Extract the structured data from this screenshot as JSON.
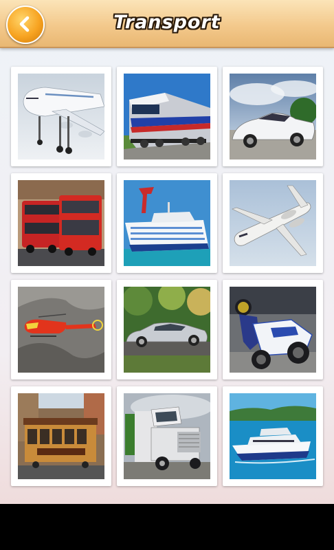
{
  "header": {
    "title": "Transport",
    "back_icon": "chevron-left-icon"
  },
  "colors": {
    "header_top": "#fbe4b8",
    "header_bottom": "#e9b772",
    "back_button": "#f7a321"
  },
  "tiles": [
    {
      "subject": "airplane"
    },
    {
      "subject": "train"
    },
    {
      "subject": "sports-car"
    },
    {
      "subject": "double-decker-bus"
    },
    {
      "subject": "cruise-ship"
    },
    {
      "subject": "jet"
    },
    {
      "subject": "helicopter"
    },
    {
      "subject": "car"
    },
    {
      "subject": "motorcycle"
    },
    {
      "subject": "cable-car"
    },
    {
      "subject": "truck"
    },
    {
      "subject": "yacht"
    }
  ]
}
